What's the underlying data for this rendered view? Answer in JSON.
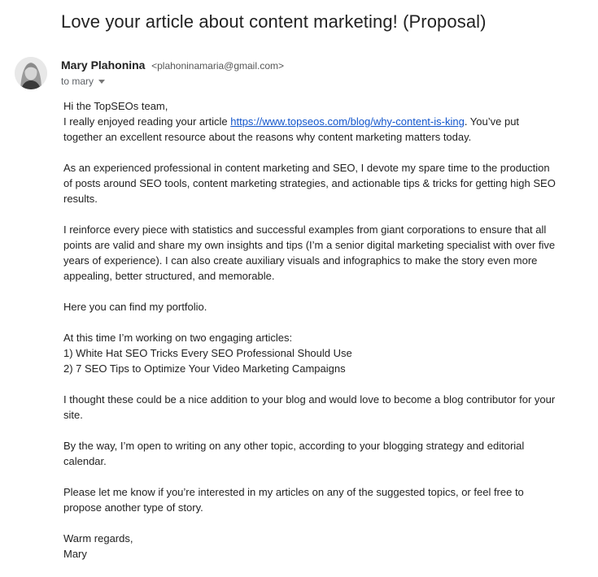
{
  "email": {
    "subject": "Love your article about content marketing! (Proposal)",
    "sender_name": "Mary Plahonina",
    "sender_email": "<plahoninamaria@gmail.com>",
    "recipient": "to mary",
    "icons": {
      "recipient_dropdown": "caret-down-icon",
      "avatar": "profile-photo"
    },
    "body": {
      "greeting": "Hi the TopSEOs team,",
      "p1_before": "I really enjoyed reading your article ",
      "p1_link": "https://www.topseos.com/blog/why-content-is-king",
      "p1_after": ". You’ve put together an excellent resource about the reasons why content marketing matters today.",
      "p2": "As an experienced professional in content marketing and SEO, I devote my spare time to the production of posts around SEO tools, content marketing strategies, and actionable tips & tricks for getting high SEO results.",
      "p3": "I reinforce every piece with statistics and successful examples from giant corporations to ensure that all points are valid and share my own insights and tips (I’m a senior digital marketing specialist with over five years of experience). I can also create auxiliary visuals and infographics to make the story even more appealing, better structured, and memorable.",
      "p4": "Here you can find my portfolio.",
      "p5_intro": "At this time I’m working on two engaging articles:",
      "p5_item1": "1) White Hat SEO Tricks Every SEO Professional Should Use",
      "p5_item2": "2) 7 SEO Tips to Optimize Your Video Marketing Campaigns",
      "p6": "I thought these could be a nice addition to your blog and would love to become a blog contributor for your site.",
      "p7": "By the way, I’m open to writing on any other topic, according to your blogging strategy and editorial calendar.",
      "p8": "Please let me know if you’re interested in my articles on any of the suggested topics, or feel free to propose another type of story.",
      "signoff": "Warm regards,",
      "signature": "Mary"
    }
  }
}
